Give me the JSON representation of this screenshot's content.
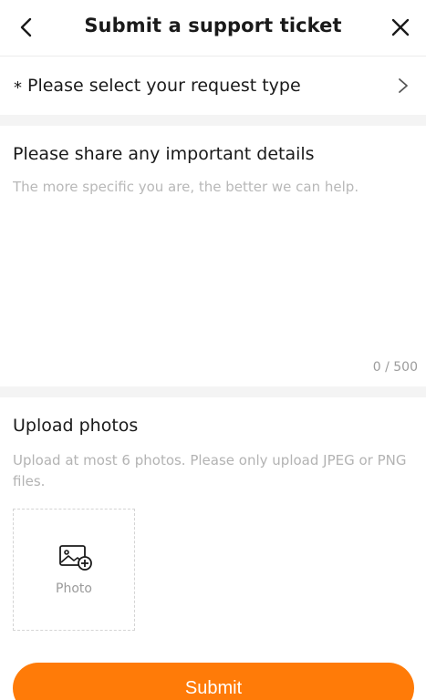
{
  "header": {
    "title": "Submit a support ticket",
    "back_icon": "chevron-left-icon",
    "close_icon": "close-icon"
  },
  "request_type": {
    "required_mark": "*",
    "label": "Please select your request type",
    "chevron_icon": "chevron-right-icon"
  },
  "details": {
    "title": "Please share any important details",
    "placeholder": "The more specific you are, the better we can help.",
    "value": "",
    "counter": "0 / 500"
  },
  "upload": {
    "title": "Upload photos",
    "hint": "Upload at most 6 photos. Please only upload JPEG or PNG files.",
    "photo_label": "Photo",
    "photo_icon": "add-image-icon"
  },
  "submit": {
    "label": "Submit"
  },
  "colors": {
    "accent": "#ff7b08",
    "placeholder": "#b8b8b8",
    "divider": "#f4f4f4"
  }
}
